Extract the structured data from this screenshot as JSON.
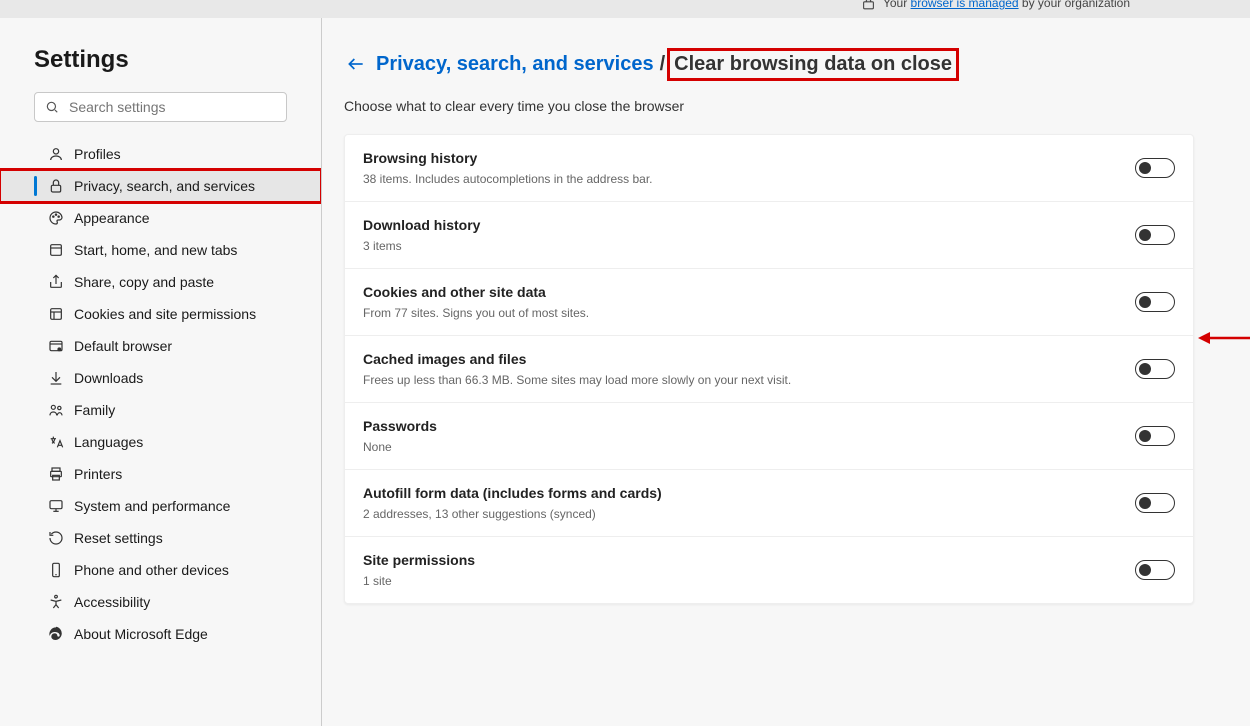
{
  "top_banner": {
    "prefix": "Your ",
    "link": "browser is managed",
    "suffix": " by your organization"
  },
  "sidebar": {
    "title": "Settings",
    "search_placeholder": "Search settings",
    "items": [
      {
        "icon": "profile-icon",
        "label": "Profiles"
      },
      {
        "icon": "lock-icon",
        "label": "Privacy, search, and services",
        "active": true,
        "highlighted": true
      },
      {
        "icon": "palette-icon",
        "label": "Appearance"
      },
      {
        "icon": "home-icon",
        "label": "Start, home, and new tabs"
      },
      {
        "icon": "share-icon",
        "label": "Share, copy and paste"
      },
      {
        "icon": "cookie-icon",
        "label": "Cookies and site permissions"
      },
      {
        "icon": "browser-icon",
        "label": "Default browser"
      },
      {
        "icon": "download-icon",
        "label": "Downloads"
      },
      {
        "icon": "family-icon",
        "label": "Family"
      },
      {
        "icon": "language-icon",
        "label": "Languages"
      },
      {
        "icon": "printer-icon",
        "label": "Printers"
      },
      {
        "icon": "system-icon",
        "label": "System and performance"
      },
      {
        "icon": "reset-icon",
        "label": "Reset settings"
      },
      {
        "icon": "phone-icon",
        "label": "Phone and other devices"
      },
      {
        "icon": "accessibility-icon",
        "label": "Accessibility"
      },
      {
        "icon": "edge-icon",
        "label": "About Microsoft Edge"
      }
    ]
  },
  "breadcrumb": {
    "parent": "Privacy, search, and services",
    "separator": "/",
    "current": "Clear browsing data on close"
  },
  "sub_heading": "Choose what to clear every time you close the browser",
  "options": [
    {
      "title": "Browsing history",
      "desc": "38 items. Includes autocompletions in the address bar.",
      "on": false
    },
    {
      "title": "Download history",
      "desc": "3 items",
      "on": false
    },
    {
      "title": "Cookies and other site data",
      "desc": "From 77 sites. Signs you out of most sites.",
      "on": false
    },
    {
      "title": "Cached images and files",
      "desc": "Frees up less than 66.3 MB. Some sites may load more slowly on your next visit.",
      "on": false
    },
    {
      "title": "Passwords",
      "desc": "None",
      "on": false
    },
    {
      "title": "Autofill form data (includes forms and cards)",
      "desc": "2 addresses, 13 other suggestions (synced)",
      "on": false
    },
    {
      "title": "Site permissions",
      "desc": "1 site",
      "on": false
    }
  ]
}
